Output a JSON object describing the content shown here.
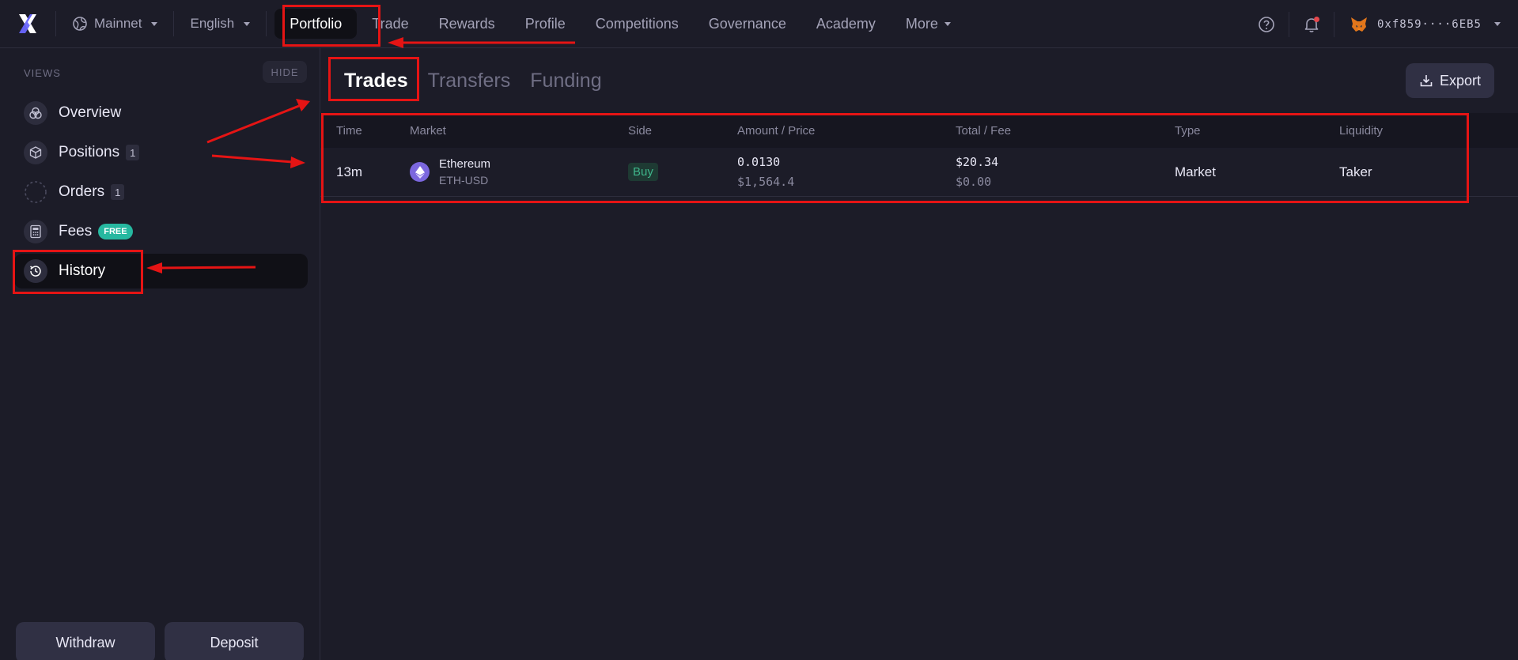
{
  "nav": {
    "network": "Mainnet",
    "language": "English",
    "links": [
      "Portfolio",
      "Trade",
      "Rewards",
      "Profile",
      "Competitions",
      "Governance",
      "Academy",
      "More"
    ],
    "active": "Portfolio",
    "wallet_address": "0xf859····6EB5",
    "icons": [
      "help-icon",
      "bell-icon",
      "metamask-fox-icon"
    ]
  },
  "sidebar": {
    "header": "VIEWS",
    "hide_label": "HIDE",
    "items": [
      {
        "label": "Overview",
        "icon": "overview-icon"
      },
      {
        "label": "Positions",
        "icon": "cube-icon",
        "badge": "1"
      },
      {
        "label": "Orders",
        "icon": "orders-icon",
        "badge": "1"
      },
      {
        "label": "Fees",
        "icon": "calculator-icon",
        "badge": "FREE"
      },
      {
        "label": "History",
        "icon": "history-icon",
        "active": true
      }
    ],
    "withdraw_label": "Withdraw",
    "deposit_label": "Deposit"
  },
  "main": {
    "tabs": [
      "Trades",
      "Transfers",
      "Funding"
    ],
    "active_tab": "Trades",
    "export_label": "Export",
    "columns": [
      "Time",
      "Market",
      "Side",
      "Amount / Price",
      "Total / Fee",
      "Type",
      "Liquidity"
    ],
    "rows": [
      {
        "time": "13m",
        "market_name": "Ethereum",
        "market_pair": "ETH-USD",
        "side": "Buy",
        "amount": "0.0130",
        "price": "$1,564.4",
        "total": "$20.34",
        "fee": "$0.00",
        "type": "Market",
        "liquidity": "Taker"
      }
    ]
  },
  "colors": {
    "background": "#1c1c28",
    "buy": "#3fb68b",
    "free_badge": "#26b8a0",
    "annotation": "#e51414"
  }
}
